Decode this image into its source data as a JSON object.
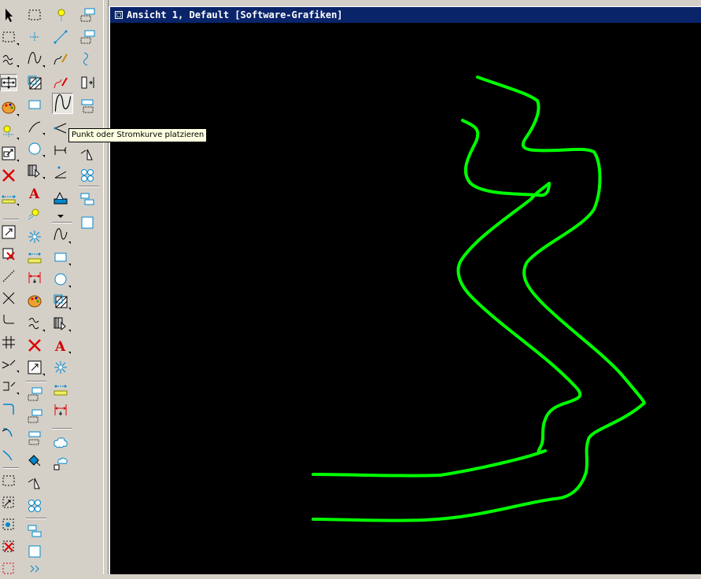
{
  "window": {
    "title": "Ansicht 1, Default [Software-Grafiken]"
  },
  "tooltip": {
    "text": "Punkt oder Stromkurve platzieren"
  },
  "toolbar": {
    "active_tool": "stream-curve-icon"
  },
  "colors": {
    "canvas_background": "#000000",
    "curve_color": "#00ff00",
    "titlebar": "#0a246a"
  },
  "canvas": {
    "element_type": "green freehand stream curves"
  }
}
